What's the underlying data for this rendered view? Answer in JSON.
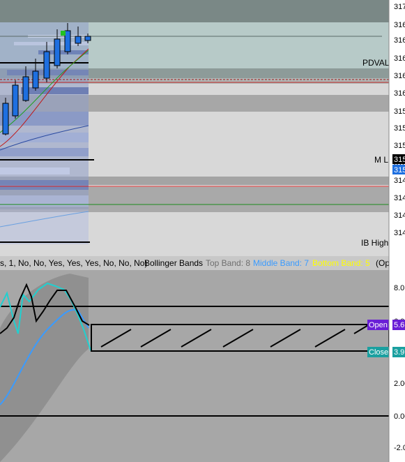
{
  "price_axis": {
    "labels": [
      "317",
      "316",
      "316",
      "316",
      "316",
      "316",
      "315",
      "315",
      "315",
      "315",
      "314",
      "314",
      "314",
      "314"
    ],
    "current_a": "315",
    "current_b": "315"
  },
  "levels": {
    "pdval": "PDVAL",
    "ml": "M L",
    "ib_high": "IB High"
  },
  "indicator_header": {
    "params": "s, 1, No, No, Yes, Yes, Yes, No, No, No)",
    "name": "Bollinger Bands",
    "top_band": "Top Band: 8",
    "middle_band": "Middle Band: 7",
    "bottom_band": "Bottom Band: 5",
    "tail": "(Op"
  },
  "lower_axis": {
    "labels": [
      "8.0",
      "6.0",
      "2.00",
      "0.00",
      "-2.0"
    ]
  },
  "markers": {
    "open_label": "Open",
    "open_value": "5.6",
    "close_label": "Close",
    "close_value": "3.9"
  },
  "colors": {
    "candle": "#1e6fe0",
    "top_band": "#7a7a7a",
    "middle_band": "#3a9bff",
    "bottom_band": "#ffff00",
    "open_badge": "#6a1fd6",
    "close_badge": "#1aa0a0",
    "current_price_bg": "#000000",
    "current_price_bg2": "#1e6fe0"
  }
}
